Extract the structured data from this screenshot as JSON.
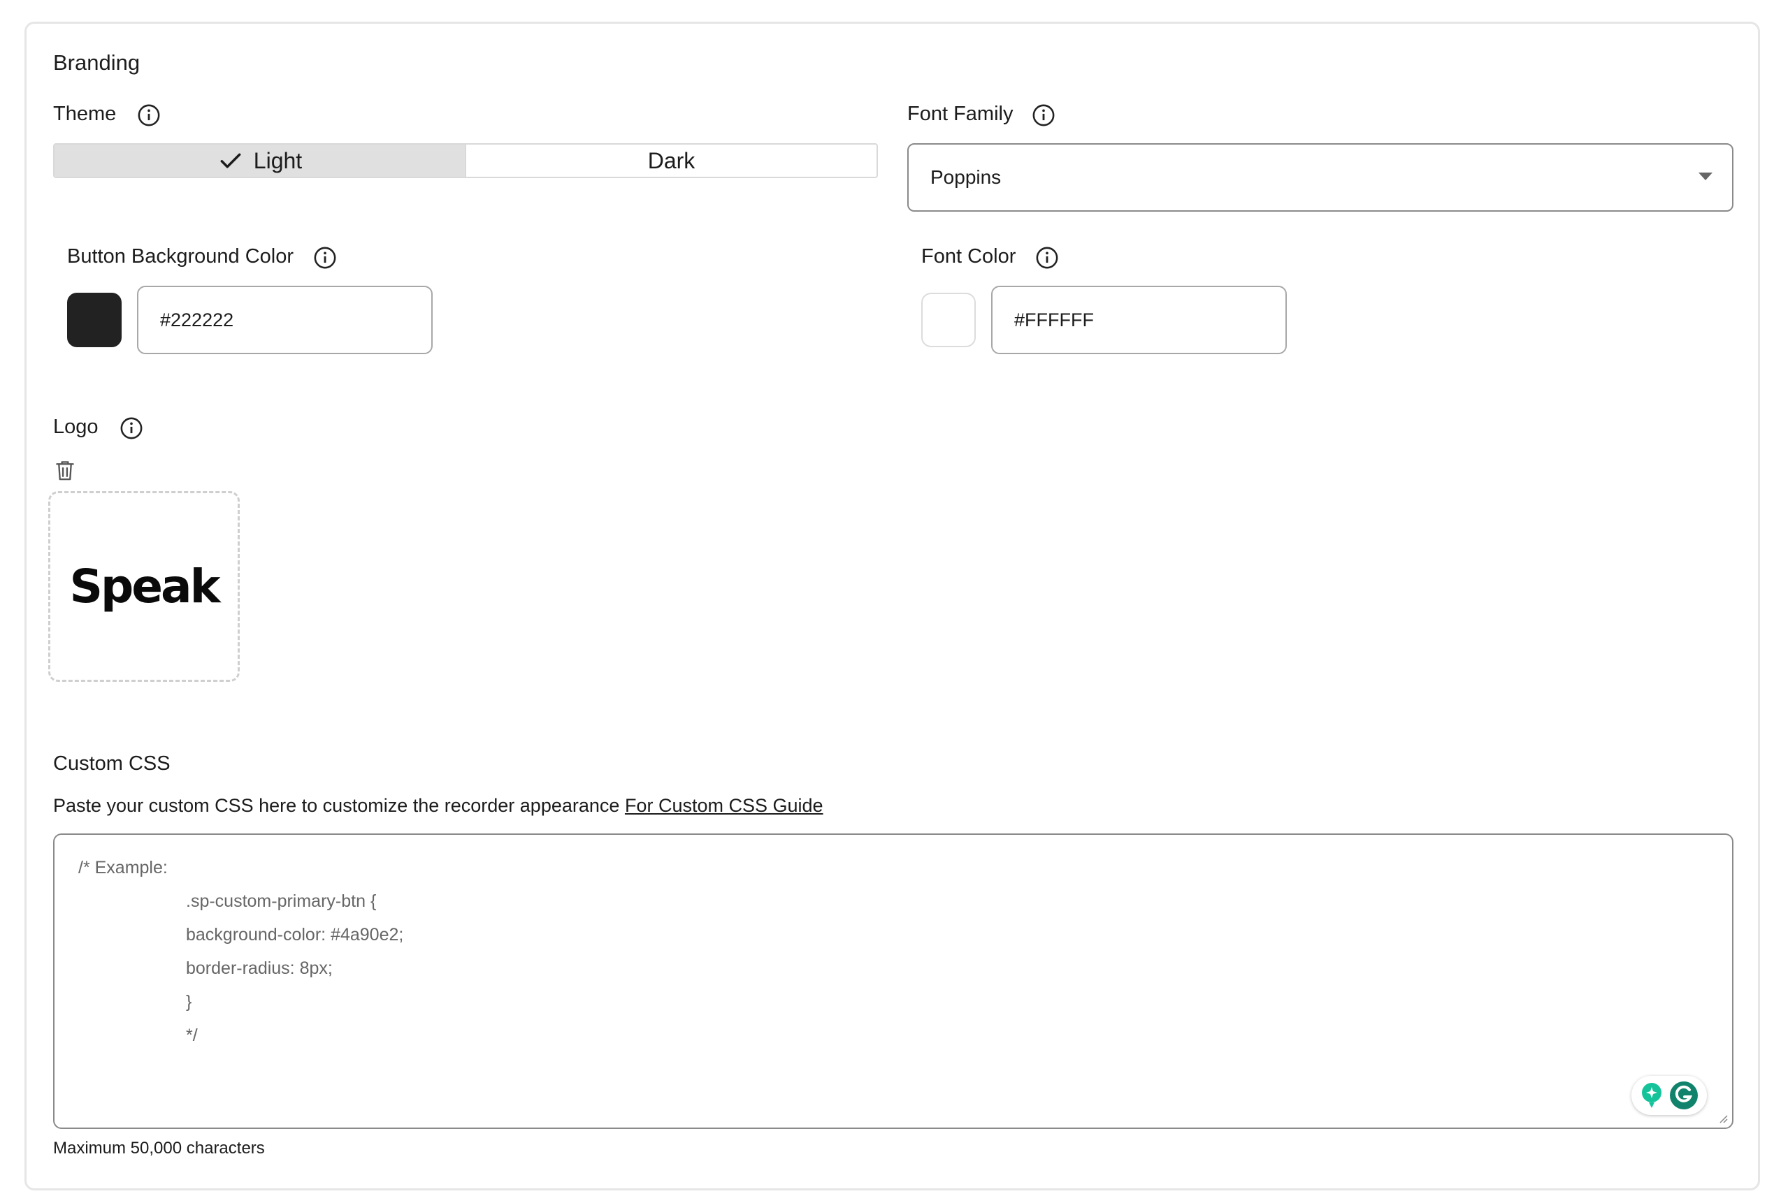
{
  "branding": {
    "title": "Branding"
  },
  "theme": {
    "label": "Theme",
    "options": [
      "Light",
      "Dark"
    ],
    "selected": "Light"
  },
  "font_family": {
    "label": "Font Family",
    "value": "Poppins"
  },
  "button_bg_color": {
    "label": "Button Background Color",
    "value": "#222222",
    "swatch_color": "#222222"
  },
  "font_color": {
    "label": "Font Color",
    "value": "#FFFFFF",
    "swatch_color": "#FFFFFF"
  },
  "logo": {
    "label": "Logo",
    "image_text": "Speak"
  },
  "custom_css": {
    "title": "Custom CSS",
    "help_text": "Paste your custom CSS here to customize the recorder appearance",
    "guide_link": "For Custom CSS Guide",
    "placeholder_lines": [
      "/* Example:",
      ".sp-custom-primary-btn {",
      "background-color: #4a90e2;",
      "border-radius: 8px;",
      "}",
      "*/"
    ],
    "limit_text": "Maximum 50,000 characters"
  },
  "icons": {
    "info": "info-circle-icon",
    "check": "check-icon",
    "trash": "trash-icon",
    "dropdown": "caret-down-icon",
    "grammarly": "grammarly-icon"
  },
  "colors": {
    "accent_grammarly": "#15c39a",
    "border": "#8a8a8a"
  }
}
